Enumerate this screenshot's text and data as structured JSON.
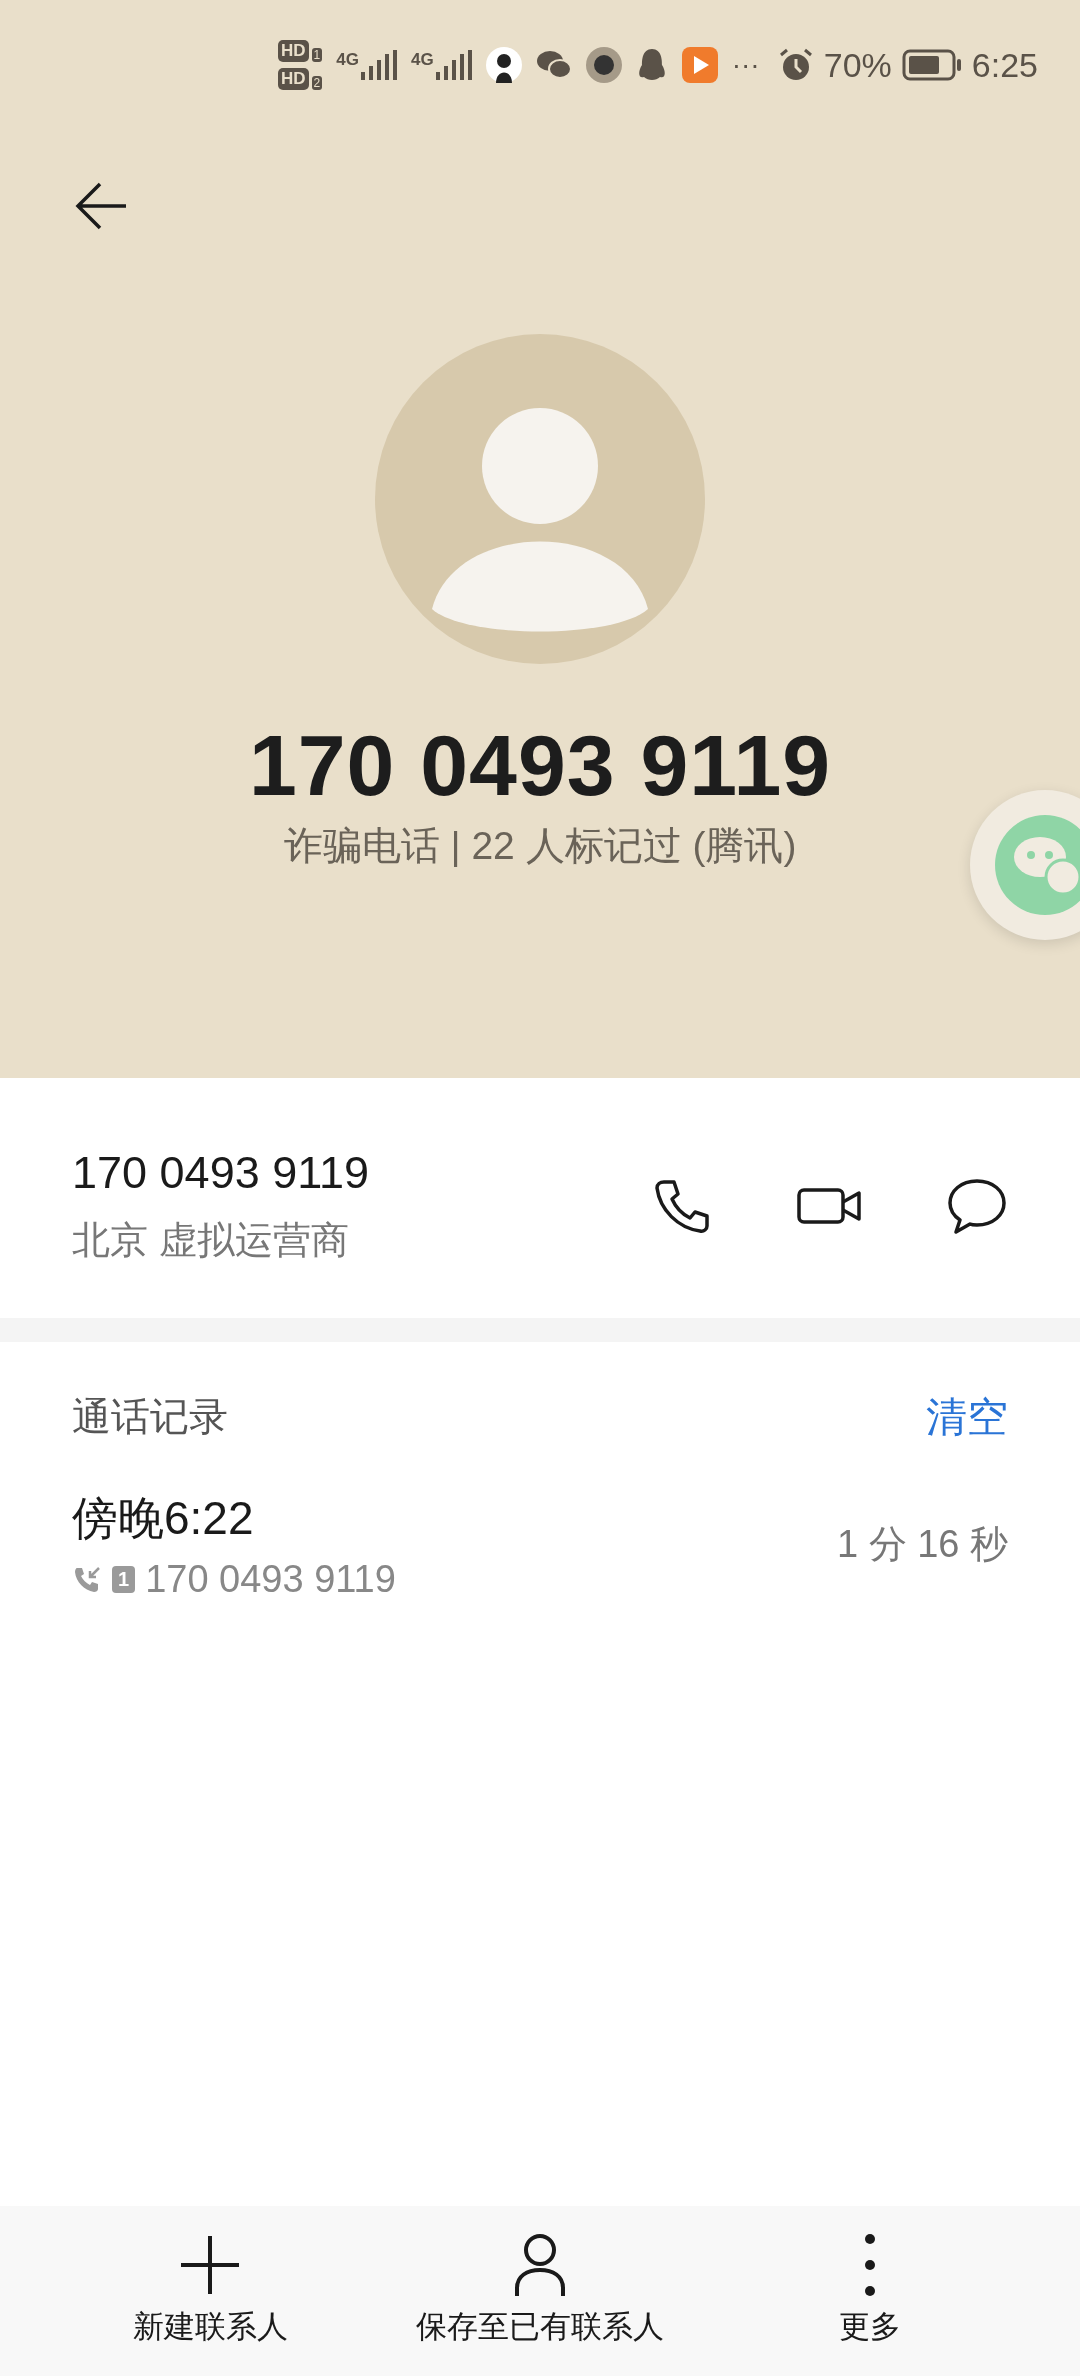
{
  "status_bar": {
    "sims": [
      {
        "badge": "HD",
        "slot": "1",
        "network": "4G"
      },
      {
        "badge": "HD",
        "slot": "2",
        "network": "4G"
      }
    ],
    "overflow": "···",
    "battery": "70%",
    "time": "6:25"
  },
  "header": {
    "number": "170 0493 9119",
    "tag": "诈骗电话 | 22 人标记过 (腾讯)"
  },
  "number_row": {
    "number": "170 0493 9119",
    "location": "北京 虚拟运营商"
  },
  "call_log": {
    "title": "通话记录",
    "clear": "清空",
    "entries": [
      {
        "time": "傍晚6:22",
        "sim": "1",
        "number": "170 0493 9119",
        "duration": "1 分 16 秒"
      }
    ]
  },
  "bottom_bar": [
    {
      "kind": "add",
      "label": "新建联系人"
    },
    {
      "kind": "person",
      "label": "保存至已有联系人"
    },
    {
      "kind": "more",
      "label": "更多"
    }
  ]
}
